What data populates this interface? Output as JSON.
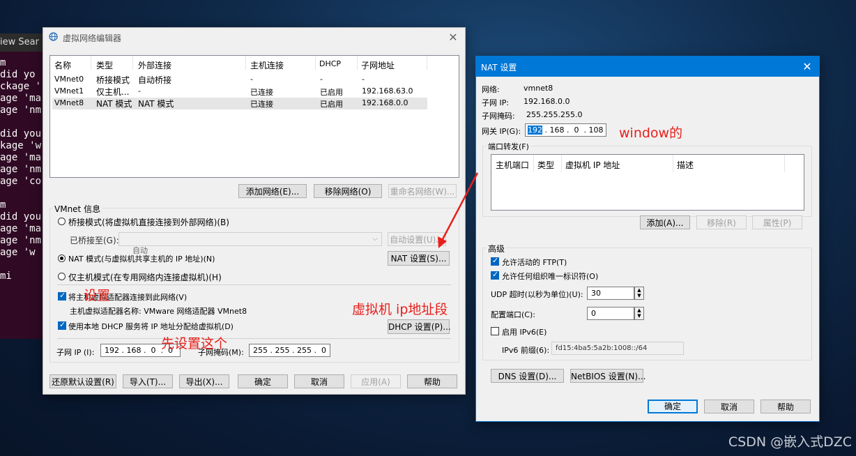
{
  "terminal": {
    "menu_text": "iew  Sear",
    "lines": [
      "m",
      "did yo",
      "ckage '",
      "age 'ma",
      "age 'nm",
      "",
      "did you",
      "kage 'w",
      "age 'ma",
      "age 'nm",
      "age 'cor",
      "",
      "m",
      "did you",
      "age 'ma",
      "age 'nm",
      "age 'w",
      "",
      "mi"
    ]
  },
  "vne": {
    "title": "虚拟网络编辑器",
    "columns": [
      "名称",
      "类型",
      "外部连接",
      "主机连接",
      "DHCP",
      "子网地址"
    ],
    "rows": [
      [
        "VMnet0",
        "桥接模式",
        "自动桥接",
        "-",
        "-",
        "-"
      ],
      [
        "VMnet1",
        "仅主机...",
        "-",
        "已连接",
        "已启用",
        "192.168.63.0"
      ],
      [
        "VMnet8",
        "NAT 模式",
        "NAT 模式",
        "已连接",
        "已启用",
        "192.168.0.0"
      ]
    ],
    "add_network": "添加网络(E)...",
    "remove_network": "移除网络(O)",
    "rename_network": "重命名网络(W)...",
    "info_group": "VMnet 信息",
    "bridged_label": "桥接模式(将虚拟机直接连接到外部网络)(B)",
    "bridged_to_label": "已桥接至(G):",
    "bridged_to_value": "自动",
    "auto_settings": "自动设置(U)...",
    "nat_label": "NAT 模式(与虚拟机共享主机的 IP 地址)(N)",
    "nat_settings": "NAT 设置(S)...",
    "hostonly_label": "仅主机模式(在专用网络内连接虚拟机)(H)",
    "connect_adapter_label": "将主机虚拟适配器连接到此网络(V)",
    "adapter_name": "主机虚拟适配器名称: VMware 网络适配器 VMnet8",
    "dhcp_label": "使用本地 DHCP 服务将 IP 地址分配给虚拟机(D)",
    "dhcp_settings": "DHCP 设置(P)...",
    "subnet_ip_label": "子网 IP (I):",
    "subnet_ip_value": "192 . 168 .  0  .  0",
    "subnet_mask_label": "子网掩码(M):",
    "subnet_mask_value": "255 . 255 . 255 .  0",
    "restore_defaults": "还原默认设置(R)",
    "import": "导入(T)...",
    "export": "导出(X)...",
    "ok": "确定",
    "cancel": "取消",
    "apply": "应用(A)",
    "help": "帮助"
  },
  "nat": {
    "title": "NAT 设置",
    "network_label": "网络:",
    "network_value": "vmnet8",
    "subnet_ip_label": "子网 IP:",
    "subnet_ip_value": "192.168.0.0",
    "subnet_mask_label": "子网掩码:",
    "subnet_mask_value": "255.255.255.0",
    "gateway_label": "网关 IP(G):",
    "gateway_sel": "192",
    "gateway_rest": " . 168 .  0  . 108",
    "port_forward_label": "端口转发(F)",
    "pf_columns": [
      "主机端口",
      "类型",
      "虚拟机 IP 地址",
      "描述"
    ],
    "add": "添加(A)...",
    "remove": "移除(R)",
    "properties": "属性(P)",
    "advanced_label": "高级",
    "allow_ftp": "允许活动的 FTP(T)",
    "allow_oui": "允许任何组织唯一标识符(O)",
    "udp_timeout_label": "UDP 超时(以秒为单位)(U):",
    "udp_timeout_value": "30",
    "config_port_label": "配置端口(C):",
    "config_port_value": "0",
    "enable_ipv6": "启用 IPv6(E)",
    "ipv6_prefix_label": "IPv6 前缀(6):",
    "ipv6_prefix_value": "fd15:4ba5:5a2b:1008::/64",
    "dns_settings": "DNS 设置(D)...",
    "netbios_settings": "NetBIOS 设置(N)...",
    "ok": "确定",
    "cancel": "取消",
    "help": "帮助"
  },
  "annotations": {
    "set": "设置",
    "vm_ip_segment": "虚拟机 ip地址段",
    "set_this_first": "先设置这个",
    "windows": "window的",
    "color": "#e8201b"
  },
  "watermark": "CSDN @嵌入式DZC"
}
